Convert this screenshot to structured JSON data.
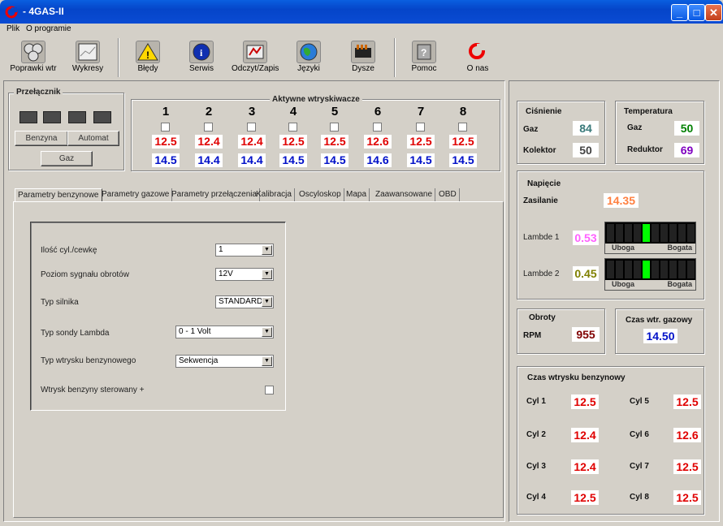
{
  "window": {
    "title": "- 4GAS-II",
    "min": "_",
    "max": "□",
    "close": "✕"
  },
  "menu": [
    "Plik",
    "O programie"
  ],
  "toolbar": [
    {
      "label": "Poprawki wtr",
      "icon": "injectors-icon"
    },
    {
      "label": "Wykresy",
      "icon": "chart-icon"
    },
    {
      "label": "Błędy",
      "icon": "warning-icon"
    },
    {
      "label": "Serwis",
      "icon": "info-icon"
    },
    {
      "label": "Odczyt/Zapis",
      "icon": "readwrite-icon"
    },
    {
      "label": "Języki",
      "icon": "globe-icon"
    },
    {
      "label": "Dysze",
      "icon": "nozzles-icon"
    },
    {
      "label": "Pomoc",
      "icon": "help-icon"
    },
    {
      "label": "O nas",
      "icon": "about-icon"
    }
  ],
  "switch_panel": {
    "title": "Przełącznik",
    "btn_petrol": "Benzyna",
    "btn_auto": "Automat",
    "btn_gas": "Gaz"
  },
  "injectors": {
    "title": "Aktywne wtryskiwacze",
    "numbers": [
      "1",
      "2",
      "3",
      "4",
      "5",
      "6",
      "7",
      "8"
    ],
    "petrol": [
      "12.5",
      "12.4",
      "12.4",
      "12.5",
      "12.5",
      "12.6",
      "12.5",
      "12.5"
    ],
    "gas": [
      "14.5",
      "14.4",
      "14.4",
      "14.5",
      "14.5",
      "14.6",
      "14.5",
      "14.5"
    ]
  },
  "tabs": [
    "Parametry benzynowe",
    "Parametry gazowe",
    "Parametry przełączenia",
    "Kalibracja",
    "Oscyloskop",
    "Mapa",
    "Zaawansowane",
    "OBD"
  ],
  "form": {
    "cyl_label": "Ilość cyl./cewkę",
    "cyl_value": "1",
    "rpm_label": "Poziom sygnału obrotów",
    "rpm_value": "12V",
    "engine_label": "Typ silnika",
    "engine_value": "STANDARD",
    "lambda_label": "Typ sondy Lambda",
    "lambda_value": "0 - 1 Volt",
    "inj_label": "Typ wtrysku benzynowego",
    "inj_value": "Sekwencja",
    "neg_label": "Wtrysk benzyny sterowany +"
  },
  "pressure": {
    "title": "Ciśnienie",
    "gas_label": "Gaz",
    "gas_value": "84",
    "coll_label": "Kolektor",
    "coll_value": "50"
  },
  "temperature": {
    "title": "Temperatura",
    "gas_label": "Gaz",
    "gas_value": "50",
    "red_label": "Reduktor",
    "red_value": "69"
  },
  "voltage": {
    "title": "Napięcie",
    "supply_label": "Zasilanie",
    "supply_value": "14.35",
    "l1_label": "Lambde 1",
    "l1_value": "0.53",
    "l2_label": "Lambde 2",
    "l2_value": "0.45",
    "lean": "Uboga",
    "rich": "Bogata",
    "l1_level": 0.6,
    "l2_level": 0.6
  },
  "rpm": {
    "title": "Obroty",
    "label": "RPM",
    "value": "955"
  },
  "gas_time": {
    "title": "Czas wtr. gazowy",
    "value": "14.50"
  },
  "petrol_time": {
    "title": "Czas wtrysku benzynowy",
    "cyls": [
      {
        "label": "Cyl 1",
        "value": "12.5"
      },
      {
        "label": "Cyl 2",
        "value": "12.4"
      },
      {
        "label": "Cyl 3",
        "value": "12.4"
      },
      {
        "label": "Cyl 4",
        "value": "12.5"
      },
      {
        "label": "Cyl 5",
        "value": "12.5"
      },
      {
        "label": "Cyl 6",
        "value": "12.6"
      },
      {
        "label": "Cyl 7",
        "value": "12.5"
      },
      {
        "label": "Cyl 8",
        "value": "12.5"
      }
    ]
  },
  "colors": {
    "pressure": "#3a7a7a",
    "temp_gas": "#008000",
    "temp_red": "#8000c0",
    "supply": "#ff8040",
    "l1": "#ff60ff",
    "l2": "#808000",
    "rpm": "#800000",
    "lambda_on": "#00ff00"
  }
}
